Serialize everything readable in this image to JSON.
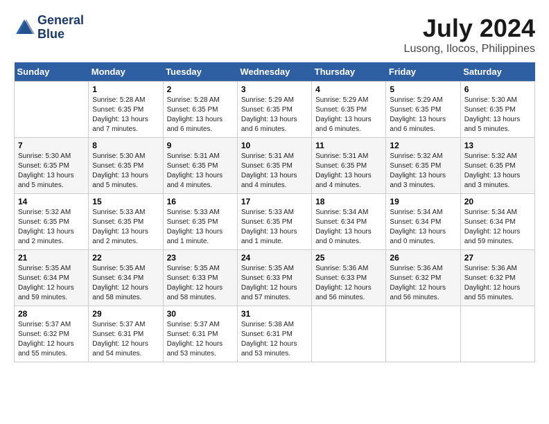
{
  "header": {
    "logo_line1": "General",
    "logo_line2": "Blue",
    "month_year": "July 2024",
    "location": "Lusong, Ilocos, Philippines"
  },
  "days_of_week": [
    "Sunday",
    "Monday",
    "Tuesday",
    "Wednesday",
    "Thursday",
    "Friday",
    "Saturday"
  ],
  "weeks": [
    [
      {
        "num": "",
        "info": ""
      },
      {
        "num": "1",
        "info": "Sunrise: 5:28 AM\nSunset: 6:35 PM\nDaylight: 13 hours\nand 7 minutes."
      },
      {
        "num": "2",
        "info": "Sunrise: 5:28 AM\nSunset: 6:35 PM\nDaylight: 13 hours\nand 6 minutes."
      },
      {
        "num": "3",
        "info": "Sunrise: 5:29 AM\nSunset: 6:35 PM\nDaylight: 13 hours\nand 6 minutes."
      },
      {
        "num": "4",
        "info": "Sunrise: 5:29 AM\nSunset: 6:35 PM\nDaylight: 13 hours\nand 6 minutes."
      },
      {
        "num": "5",
        "info": "Sunrise: 5:29 AM\nSunset: 6:35 PM\nDaylight: 13 hours\nand 6 minutes."
      },
      {
        "num": "6",
        "info": "Sunrise: 5:30 AM\nSunset: 6:35 PM\nDaylight: 13 hours\nand 5 minutes."
      }
    ],
    [
      {
        "num": "7",
        "info": "Sunrise: 5:30 AM\nSunset: 6:35 PM\nDaylight: 13 hours\nand 5 minutes."
      },
      {
        "num": "8",
        "info": "Sunrise: 5:30 AM\nSunset: 6:35 PM\nDaylight: 13 hours\nand 5 minutes."
      },
      {
        "num": "9",
        "info": "Sunrise: 5:31 AM\nSunset: 6:35 PM\nDaylight: 13 hours\nand 4 minutes."
      },
      {
        "num": "10",
        "info": "Sunrise: 5:31 AM\nSunset: 6:35 PM\nDaylight: 13 hours\nand 4 minutes."
      },
      {
        "num": "11",
        "info": "Sunrise: 5:31 AM\nSunset: 6:35 PM\nDaylight: 13 hours\nand 4 minutes."
      },
      {
        "num": "12",
        "info": "Sunrise: 5:32 AM\nSunset: 6:35 PM\nDaylight: 13 hours\nand 3 minutes."
      },
      {
        "num": "13",
        "info": "Sunrise: 5:32 AM\nSunset: 6:35 PM\nDaylight: 13 hours\nand 3 minutes."
      }
    ],
    [
      {
        "num": "14",
        "info": "Sunrise: 5:32 AM\nSunset: 6:35 PM\nDaylight: 13 hours\nand 2 minutes."
      },
      {
        "num": "15",
        "info": "Sunrise: 5:33 AM\nSunset: 6:35 PM\nDaylight: 13 hours\nand 2 minutes."
      },
      {
        "num": "16",
        "info": "Sunrise: 5:33 AM\nSunset: 6:35 PM\nDaylight: 13 hours\nand 1 minute."
      },
      {
        "num": "17",
        "info": "Sunrise: 5:33 AM\nSunset: 6:35 PM\nDaylight: 13 hours\nand 1 minute."
      },
      {
        "num": "18",
        "info": "Sunrise: 5:34 AM\nSunset: 6:34 PM\nDaylight: 13 hours\nand 0 minutes."
      },
      {
        "num": "19",
        "info": "Sunrise: 5:34 AM\nSunset: 6:34 PM\nDaylight: 13 hours\nand 0 minutes."
      },
      {
        "num": "20",
        "info": "Sunrise: 5:34 AM\nSunset: 6:34 PM\nDaylight: 12 hours\nand 59 minutes."
      }
    ],
    [
      {
        "num": "21",
        "info": "Sunrise: 5:35 AM\nSunset: 6:34 PM\nDaylight: 12 hours\nand 59 minutes."
      },
      {
        "num": "22",
        "info": "Sunrise: 5:35 AM\nSunset: 6:34 PM\nDaylight: 12 hours\nand 58 minutes."
      },
      {
        "num": "23",
        "info": "Sunrise: 5:35 AM\nSunset: 6:33 PM\nDaylight: 12 hours\nand 58 minutes."
      },
      {
        "num": "24",
        "info": "Sunrise: 5:35 AM\nSunset: 6:33 PM\nDaylight: 12 hours\nand 57 minutes."
      },
      {
        "num": "25",
        "info": "Sunrise: 5:36 AM\nSunset: 6:33 PM\nDaylight: 12 hours\nand 56 minutes."
      },
      {
        "num": "26",
        "info": "Sunrise: 5:36 AM\nSunset: 6:32 PM\nDaylight: 12 hours\nand 56 minutes."
      },
      {
        "num": "27",
        "info": "Sunrise: 5:36 AM\nSunset: 6:32 PM\nDaylight: 12 hours\nand 55 minutes."
      }
    ],
    [
      {
        "num": "28",
        "info": "Sunrise: 5:37 AM\nSunset: 6:32 PM\nDaylight: 12 hours\nand 55 minutes."
      },
      {
        "num": "29",
        "info": "Sunrise: 5:37 AM\nSunset: 6:31 PM\nDaylight: 12 hours\nand 54 minutes."
      },
      {
        "num": "30",
        "info": "Sunrise: 5:37 AM\nSunset: 6:31 PM\nDaylight: 12 hours\nand 53 minutes."
      },
      {
        "num": "31",
        "info": "Sunrise: 5:38 AM\nSunset: 6:31 PM\nDaylight: 12 hours\nand 53 minutes."
      },
      {
        "num": "",
        "info": ""
      },
      {
        "num": "",
        "info": ""
      },
      {
        "num": "",
        "info": ""
      }
    ]
  ]
}
